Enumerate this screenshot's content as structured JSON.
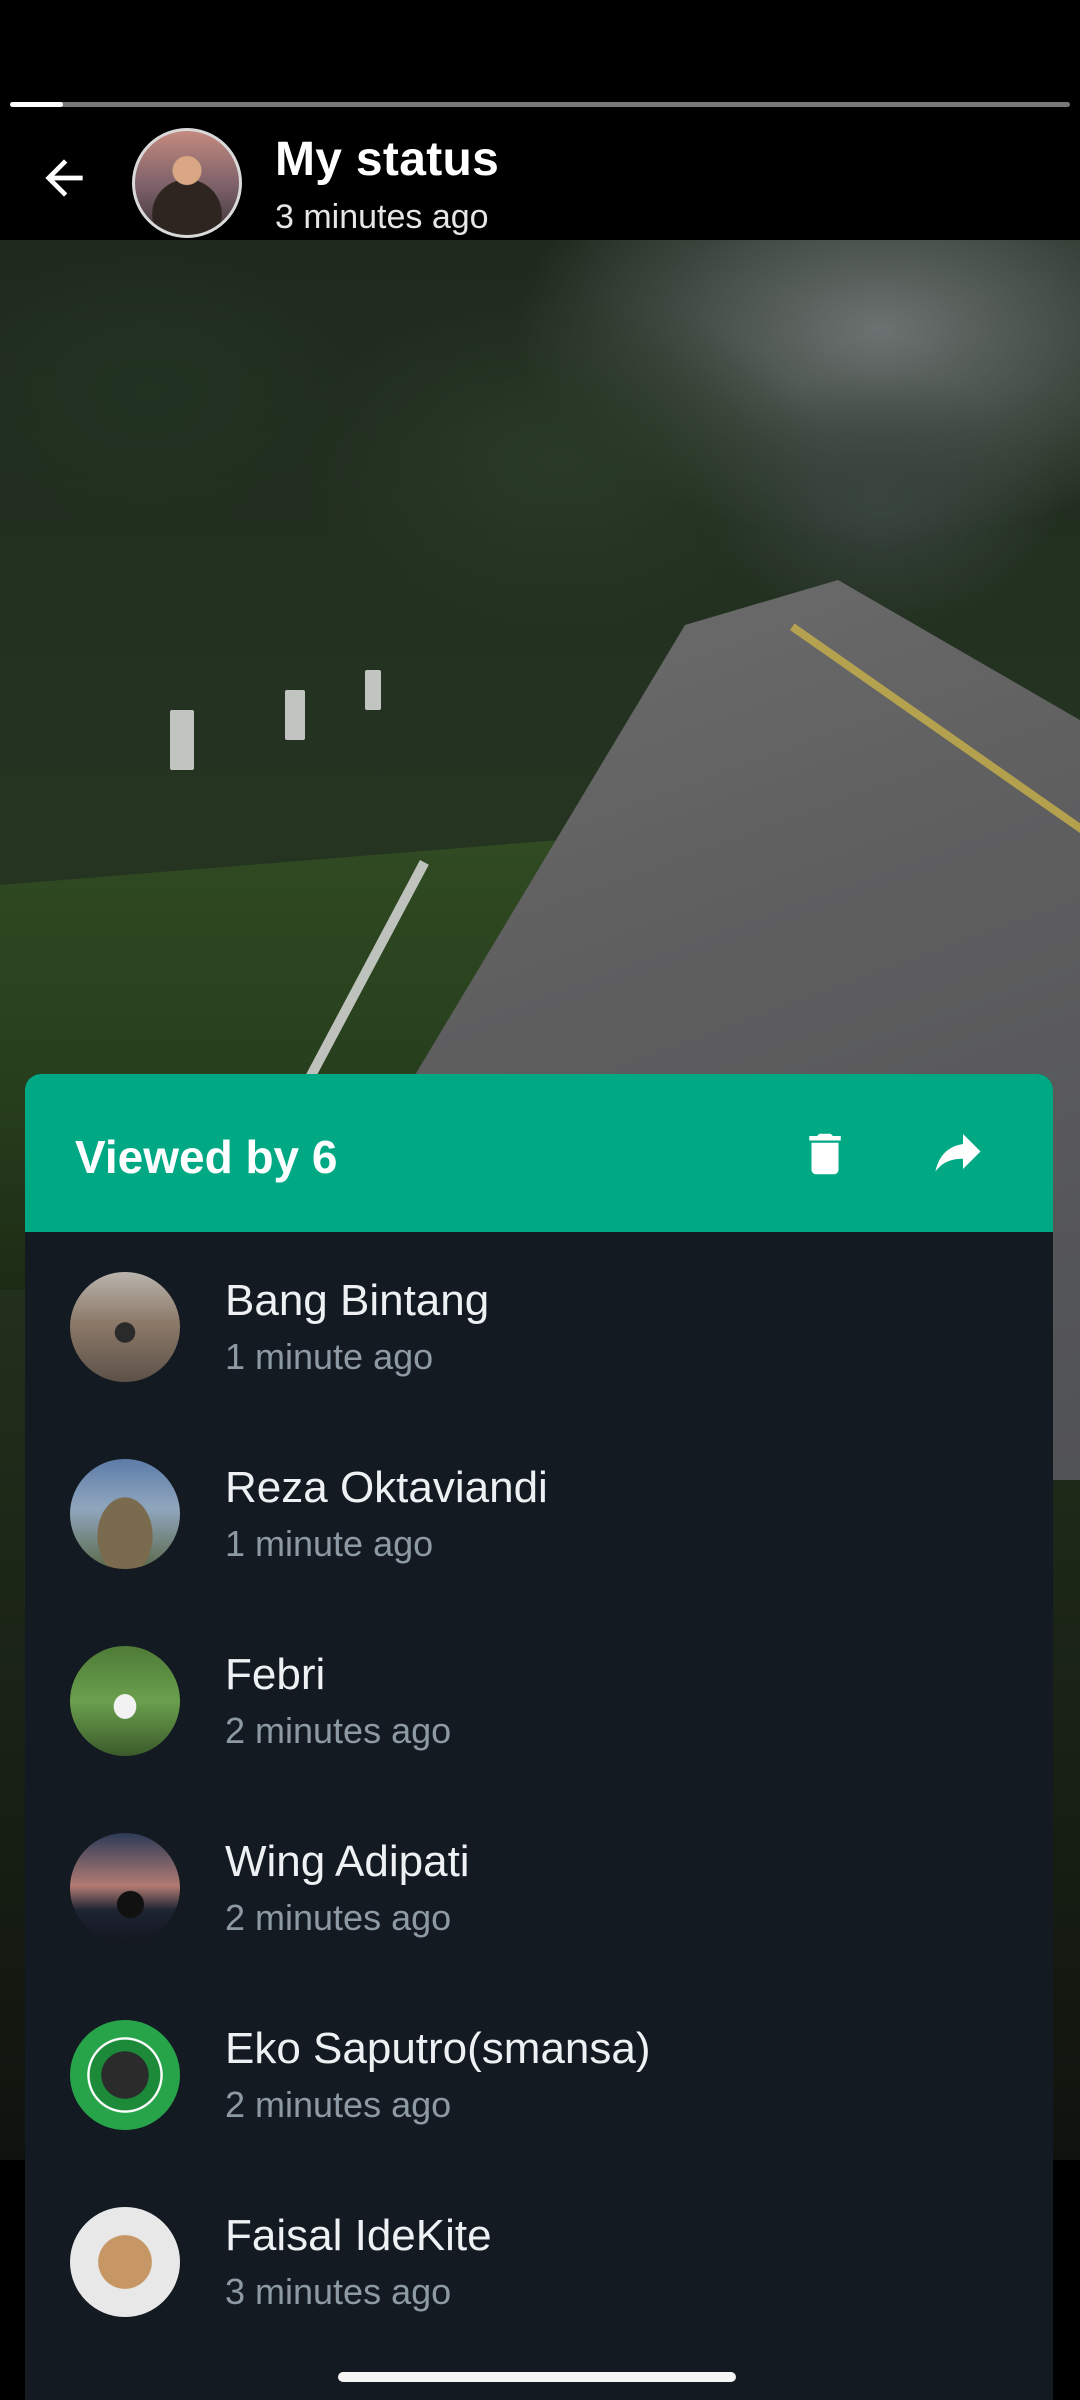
{
  "status": {
    "title": "My status",
    "time": "3 minutes ago",
    "progress_fraction": 0.05
  },
  "viewers_panel": {
    "header_text": "Viewed by 6",
    "accent_color": "#00a884",
    "viewers": [
      {
        "name": "Bang Bintang",
        "time": "1 minute ago"
      },
      {
        "name": "Reza Oktaviandi",
        "time": "1 minute ago"
      },
      {
        "name": "Febri",
        "time": "2 minutes ago"
      },
      {
        "name": "Wing Adipati",
        "time": "2 minutes ago"
      },
      {
        "name": "Eko Saputro(smansa)",
        "time": "2 minutes ago"
      },
      {
        "name": "Faisal IdeKite",
        "time": "3 minutes ago"
      }
    ]
  },
  "icons": {
    "back": "arrow-left-icon",
    "delete": "trash-icon",
    "forward": "share-forward-icon"
  }
}
